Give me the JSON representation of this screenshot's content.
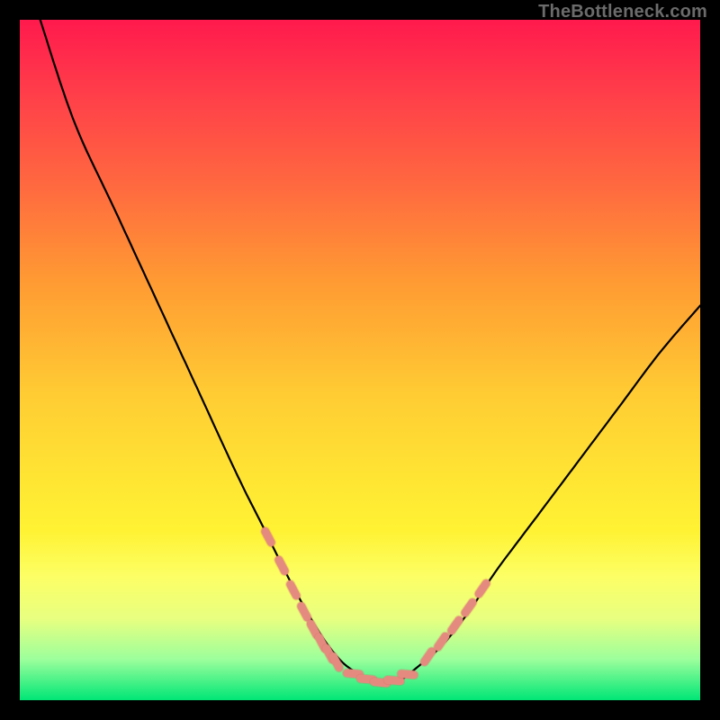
{
  "watermark": "TheBottleneck.com",
  "colors": {
    "frame": "#000000",
    "curve_stroke": "#000000",
    "marker_fill": "#e58a7f",
    "marker_stroke": "#d46f63"
  },
  "chart_data": {
    "type": "line",
    "title": "",
    "xlabel": "",
    "ylabel": "",
    "xlim": [
      0,
      100
    ],
    "ylim": [
      0,
      100
    ],
    "grid": false,
    "legend": false,
    "series": [
      {
        "name": "curve",
        "x": [
          3,
          8,
          14,
          20,
          26,
          32,
          36,
          40,
          44,
          47,
          49.5,
          51.5,
          54,
          56,
          58,
          62,
          66,
          70,
          76,
          82,
          88,
          94,
          100
        ],
        "y": [
          100,
          85,
          72,
          59,
          46,
          33,
          25,
          17,
          10,
          6,
          4,
          3,
          2.5,
          3,
          4.5,
          8,
          13,
          19,
          27,
          35,
          43,
          51,
          58
        ]
      }
    ],
    "markers": {
      "left_cluster": {
        "x": [
          36.5,
          38.5,
          40.2,
          41.8,
          43.2,
          44.4,
          45.5,
          46.5
        ],
        "y": [
          24,
          19.8,
          16.2,
          13.0,
          10.4,
          8.4,
          6.8,
          5.6
        ]
      },
      "bottom_cluster": {
        "x": [
          49.0,
          51.0,
          53.0,
          55.0,
          57.0
        ],
        "y": [
          3.9,
          3.1,
          2.6,
          2.9,
          3.8
        ]
      },
      "right_cluster": {
        "x": [
          60.0,
          62.0,
          64.0,
          66.0,
          68.0
        ],
        "y": [
          6.4,
          8.6,
          11.0,
          13.6,
          16.4
        ]
      }
    }
  }
}
